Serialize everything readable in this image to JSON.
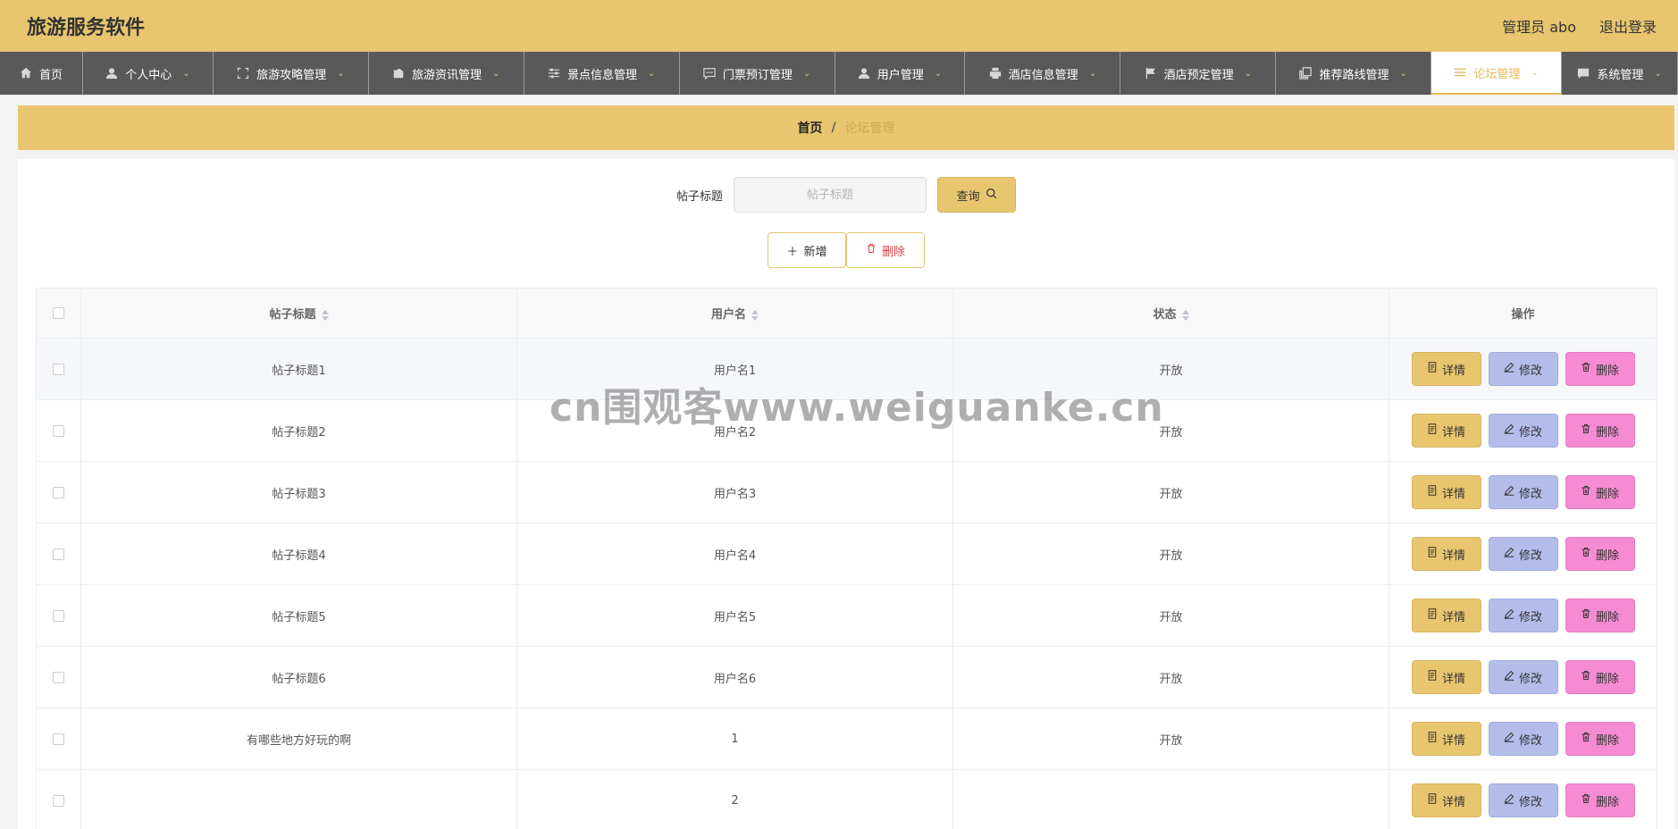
{
  "header": {
    "title": "旅游服务软件",
    "user": "管理员 abo",
    "logout": "退出登录"
  },
  "nav": [
    {
      "label": "首页",
      "icon": "home-icon",
      "chevron": false
    },
    {
      "label": "个人中心",
      "icon": "user-icon",
      "chevron": true
    },
    {
      "label": "旅游攻略管理",
      "icon": "scan-icon",
      "chevron": true
    },
    {
      "label": "旅游资讯管理",
      "icon": "wallet-icon",
      "chevron": true
    },
    {
      "label": "景点信息管理",
      "icon": "sliders-icon",
      "chevron": true
    },
    {
      "label": "门票预订管理",
      "icon": "chat-icon",
      "chevron": true
    },
    {
      "label": "用户管理",
      "icon": "user-icon",
      "chevron": true
    },
    {
      "label": "酒店信息管理",
      "icon": "printer-icon",
      "chevron": true
    },
    {
      "label": "酒店预定管理",
      "icon": "flag-icon",
      "chevron": true
    },
    {
      "label": "推荐路线管理",
      "icon": "copy-icon",
      "chevron": true
    },
    {
      "label": "论坛管理",
      "icon": "menu-icon",
      "chevron": true,
      "active": true
    },
    {
      "label": "系统管理",
      "icon": "message-icon",
      "chevron": true
    }
  ],
  "breadcrumb": {
    "home": "首页",
    "sep": "/",
    "current": "论坛管理"
  },
  "search": {
    "label": "帖子标题",
    "placeholder": "帖子标题",
    "button": "查询"
  },
  "actions": {
    "add": "新增",
    "delete": "删除"
  },
  "table": {
    "columns": [
      "帖子标题",
      "用户名",
      "状态",
      "操作"
    ],
    "rows": [
      {
        "title": "帖子标题1",
        "user": "用户名1",
        "status": "开放"
      },
      {
        "title": "帖子标题2",
        "user": "用户名2",
        "status": "开放"
      },
      {
        "title": "帖子标题3",
        "user": "用户名3",
        "status": "开放"
      },
      {
        "title": "帖子标题4",
        "user": "用户名4",
        "status": "开放"
      },
      {
        "title": "帖子标题5",
        "user": "用户名5",
        "status": "开放"
      },
      {
        "title": "帖子标题6",
        "user": "用户名6",
        "status": "开放"
      },
      {
        "title": "有哪些地方好玩的啊",
        "user": "1",
        "status": "开放"
      },
      {
        "title": "",
        "user": "2",
        "status": ""
      }
    ],
    "op_labels": {
      "detail": "详情",
      "edit": "修改",
      "delete": "删除"
    }
  },
  "watermark": "cn围观客www.weiguanke.cn",
  "colors": {
    "accent": "#e8c66f",
    "nav_bg": "#595959",
    "edit": "#b4bdea",
    "delete": "#f58bd2"
  }
}
